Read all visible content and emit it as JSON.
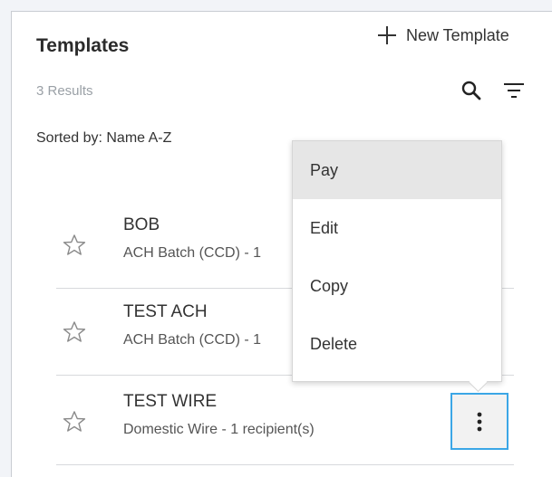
{
  "header": {
    "title": "Templates",
    "new_template_label": "New Template",
    "results_text": "3 Results",
    "sorted_text": "Sorted by: Name A-Z"
  },
  "templates": [
    {
      "name": "BOB",
      "description": "ACH Batch (CCD) - 1"
    },
    {
      "name": "TEST ACH",
      "description": "ACH Batch (CCD) - 1"
    },
    {
      "name": "TEST WIRE",
      "description": "Domestic Wire - 1 recipient(s)"
    }
  ],
  "menu": {
    "items": [
      "Pay",
      "Edit",
      "Copy",
      "Delete"
    ],
    "active_item": "Pay"
  },
  "colors": {
    "focus_border": "#3ba6e6",
    "menu_highlight": "#e6e6e6"
  },
  "icons": [
    "plus-icon",
    "search-icon",
    "filter-icon",
    "star-outline-icon",
    "kebab-icon"
  ]
}
